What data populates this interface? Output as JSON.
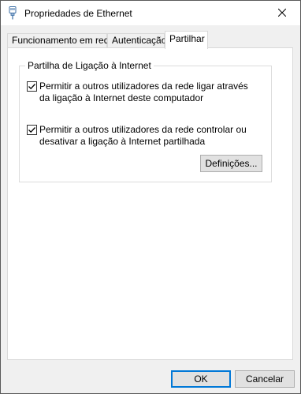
{
  "window": {
    "title": "Propriedades de Ethernet",
    "icon": "network-adapter-icon",
    "close_icon": "close-icon"
  },
  "tabs": [
    {
      "label": "Funcionamento em rede",
      "active": false
    },
    {
      "label": "Autenticação",
      "active": false
    },
    {
      "label": "Partilhar",
      "active": true
    }
  ],
  "group": {
    "legend": "Partilha de Ligação à Internet",
    "options": [
      {
        "label": "Permitir a outros utilizadores da rede ligar através da ligação à Internet deste computador",
        "checked": true
      },
      {
        "label": "Permitir a outros utilizadores da rede controlar ou desativar a ligação à Internet partilhada",
        "checked": true
      }
    ],
    "settings_button": "Definições..."
  },
  "footer": {
    "ok_label": "OK",
    "cancel_label": "Cancelar"
  },
  "colors": {
    "accent": "#0078d7",
    "dialog_bg": "#f0f0f0",
    "panel_bg": "#ffffff"
  }
}
